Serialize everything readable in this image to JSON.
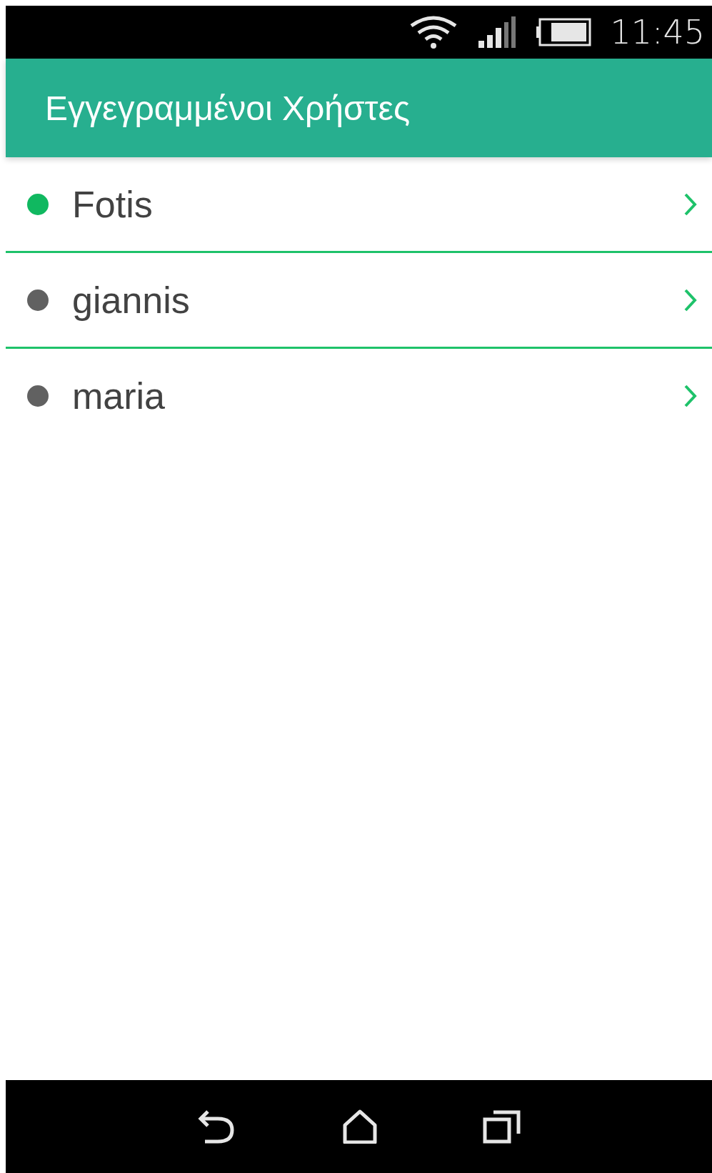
{
  "status_bar": {
    "time": "11:45"
  },
  "app_bar": {
    "title": "Εγγεγραμμένοι Χρήστες"
  },
  "users": [
    {
      "name": "Fotis",
      "color": "#10b860"
    },
    {
      "name": "giannis",
      "color": "#616161"
    },
    {
      "name": "maria",
      "color": "#616161"
    }
  ]
}
